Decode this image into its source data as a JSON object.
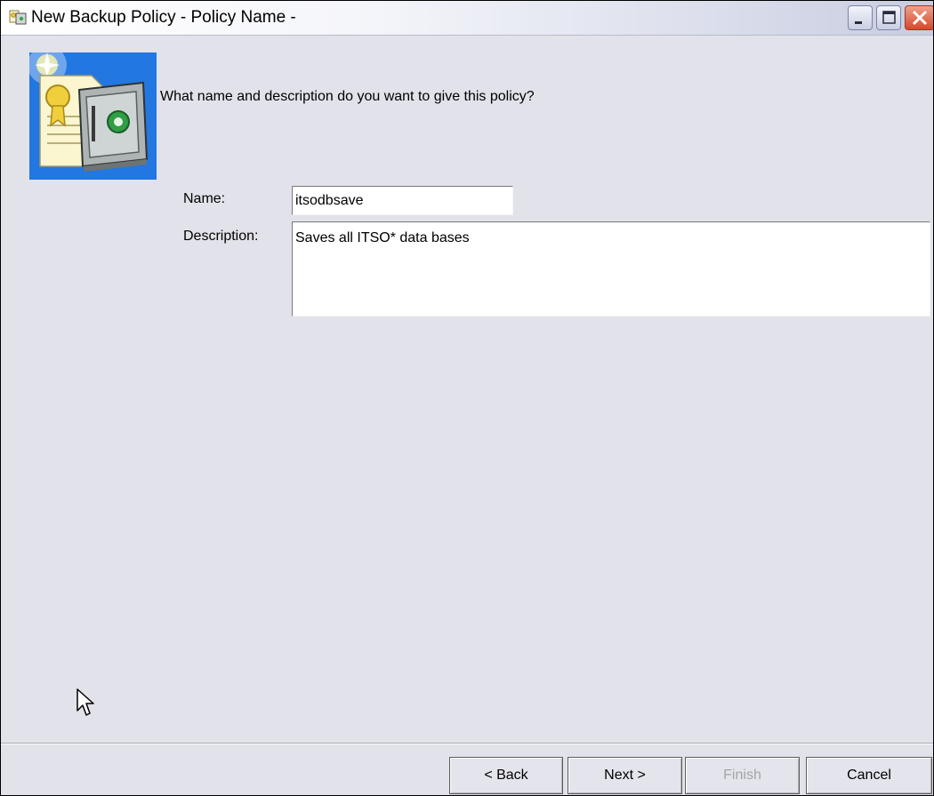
{
  "window": {
    "title": "New Backup Policy - Policy Name -",
    "controls": {
      "minimize": "minimize-icon",
      "maximize": "maximize-icon",
      "close": "close-icon"
    },
    "title_icon": "backup-policy-icon",
    "close_color": "#d24a2c"
  },
  "wizard": {
    "icon": "safe-with-certificate-icon",
    "prompt": "What name and description do you want to give this policy?"
  },
  "form": {
    "name_label": "Name:",
    "name_value": "itsodbsave",
    "description_label": "Description:",
    "description_value": "Saves all ITSO* data bases"
  },
  "buttons": {
    "back": "< Back",
    "next": "Next >",
    "finish": "Finish",
    "cancel": "Cancel"
  },
  "colors": {
    "background": "#e2e2ea",
    "disabled_text": "#a4a4aa",
    "art_background": "#2277e0"
  },
  "cursor": "mouse-pointer-icon"
}
